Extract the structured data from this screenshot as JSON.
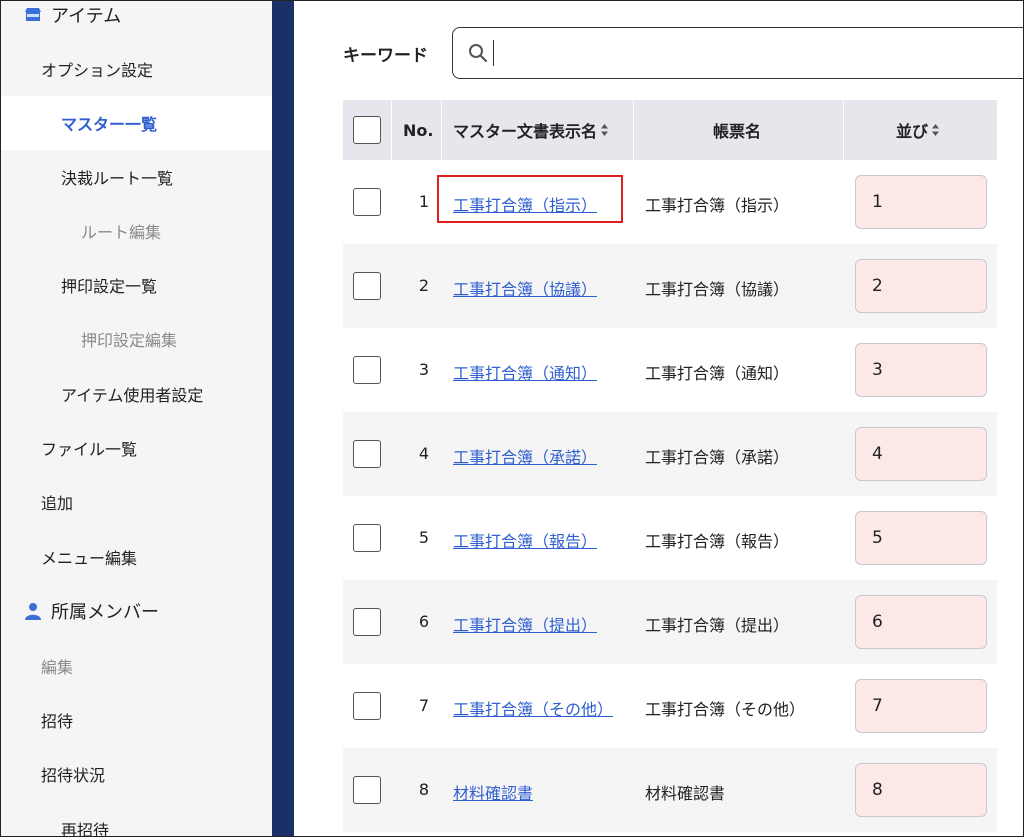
{
  "sidebar": {
    "items": [
      {
        "label": "アイテム",
        "level": "section",
        "icon": "store-icon"
      },
      {
        "label": "オプション設定",
        "level": "lv0"
      },
      {
        "label": "マスター一覧",
        "level": "lv1",
        "active": true
      },
      {
        "label": "決裁ルート一覧",
        "level": "lv1"
      },
      {
        "label": "ルート編集",
        "level": "lv2",
        "muted": true
      },
      {
        "label": "押印設定一覧",
        "level": "lv1"
      },
      {
        "label": "押印設定編集",
        "level": "lv2",
        "muted": true
      },
      {
        "label": "アイテム使用者設定",
        "level": "lv1"
      },
      {
        "label": "ファイル一覧",
        "level": "lv0"
      },
      {
        "label": "追加",
        "level": "lv0"
      },
      {
        "label": "メニュー編集",
        "level": "lv0"
      },
      {
        "label": "所属メンバー",
        "level": "section",
        "icon": "person-icon"
      },
      {
        "label": "編集",
        "level": "lv0",
        "muted": true
      },
      {
        "label": "招待",
        "level": "lv0"
      },
      {
        "label": "招待状況",
        "level": "lv0"
      },
      {
        "label": "再招待",
        "level": "lv1"
      }
    ]
  },
  "search": {
    "label": "キーワード",
    "value": "",
    "placeholder": ""
  },
  "table": {
    "headers": {
      "no": "No.",
      "master_name": "マスター文書表示名",
      "form_name": "帳票名",
      "order": "並び"
    },
    "rows": [
      {
        "no": "1",
        "master_name": "工事打合簿（指示）",
        "form_name": "工事打合簿（指示）",
        "order": "1"
      },
      {
        "no": "2",
        "master_name": "工事打合簿（協議）",
        "form_name": "工事打合簿（協議）",
        "order": "2"
      },
      {
        "no": "3",
        "master_name": "工事打合簿（通知）",
        "form_name": "工事打合簿（通知）",
        "order": "3"
      },
      {
        "no": "4",
        "master_name": "工事打合簿（承諾）",
        "form_name": "工事打合簿（承諾）",
        "order": "4"
      },
      {
        "no": "5",
        "master_name": "工事打合簿（報告）",
        "form_name": "工事打合簿（報告）",
        "order": "5"
      },
      {
        "no": "6",
        "master_name": "工事打合簿（提出）",
        "form_name": "工事打合簿（提出）",
        "order": "6"
      },
      {
        "no": "7",
        "master_name": "工事打合簿（その他）",
        "form_name": "工事打合簿（その他）",
        "order": "7"
      },
      {
        "no": "8",
        "master_name": "材料確認書",
        "form_name": "材料確認書",
        "order": "8"
      }
    ]
  },
  "colors": {
    "accent": "#2f5fd0",
    "divider": "#1c3068",
    "order_bg": "#fde8e8",
    "highlight": "#e02020"
  }
}
